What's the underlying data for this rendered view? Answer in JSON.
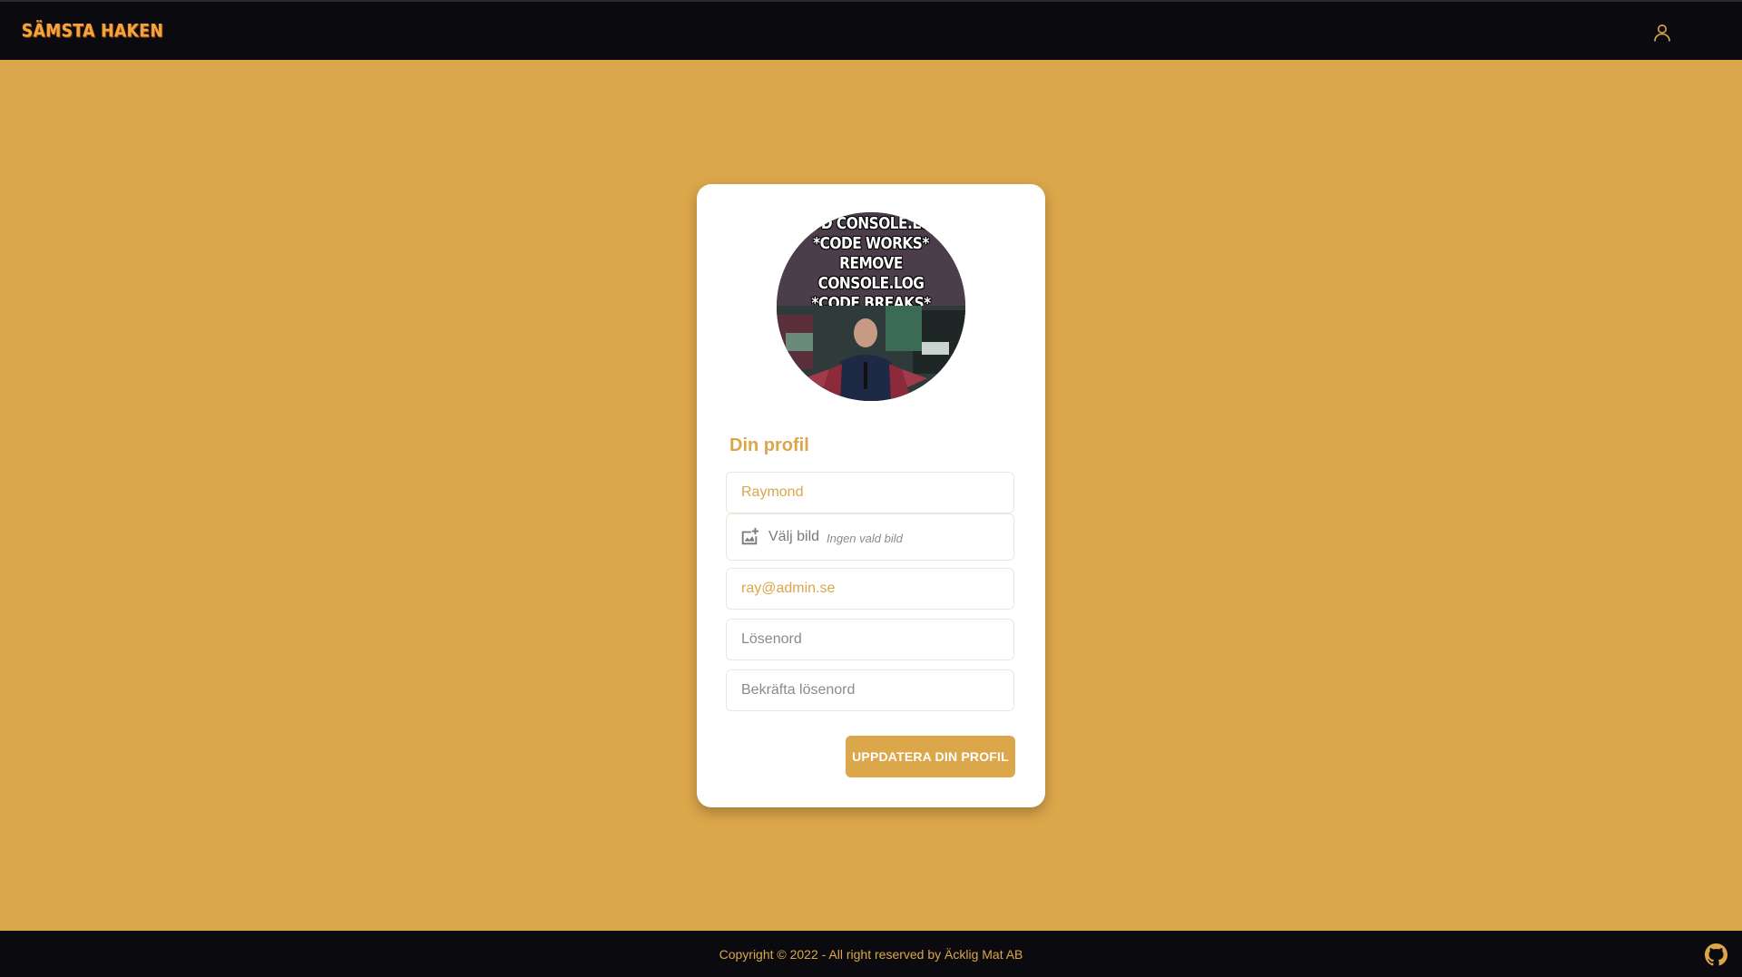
{
  "header": {
    "logo_text": "SÄMSTA HAKEN",
    "profile_icon": "user-icon"
  },
  "profile": {
    "avatar": {
      "meme_lines": [
        "*ADD CONSOLE.LOG*",
        "*CODE WORKS*",
        "REMOVE CONSOLE.LOG",
        "*CODE BREAKS*"
      ]
    },
    "title": "Din profil",
    "name_placeholder": "Raymond",
    "image_button_label": "Välj bild",
    "image_status": "Ingen vald bild",
    "image_icon": "add-photo-icon",
    "email_placeholder": "ray@admin.se",
    "password_placeholder": "Lösenord",
    "confirm_password_placeholder": "Bekräfta lösenord",
    "submit_label": "UPPDATERA DIN PROFIL"
  },
  "footer": {
    "copyright": "Copyright © 2022 - All right reserved by Äcklig Mat AB",
    "github_icon": "github-icon"
  },
  "colors": {
    "accent": "#dca64a",
    "dark": "#0b0b0f",
    "card": "#ffffff"
  }
}
